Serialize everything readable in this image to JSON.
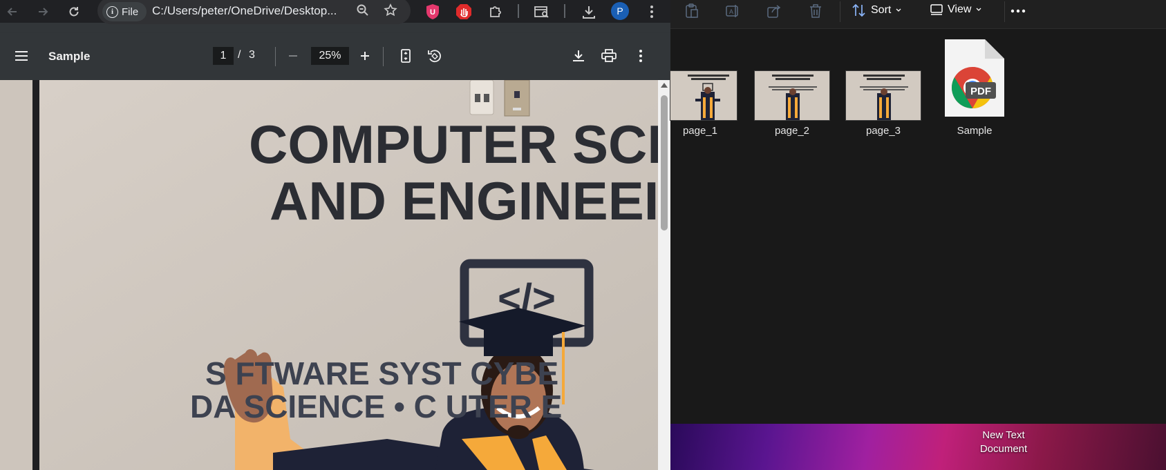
{
  "browser": {
    "back_icon": "arrow-left-icon",
    "forward_icon": "arrow-right-icon",
    "reload_icon": "reload-icon",
    "site_info": {
      "icon": "info-icon",
      "label": "File"
    },
    "url": "C:/Users/peter/OneDrive/Desktop...",
    "zoom_icon": "zoom-icon",
    "bookmark_icon": "star-icon",
    "extensions": [
      {
        "name": "ublock-extension-icon",
        "letter": "U",
        "color": "#e5386d"
      },
      {
        "name": "adblock-extension-icon",
        "color": "#e02b2b"
      },
      {
        "name": "puzzle-icon"
      }
    ],
    "profile_initial": "P"
  },
  "pdf_viewer": {
    "title": "Sample",
    "current_page": "1",
    "page_separator": "/",
    "total_pages": "3",
    "zoom": "25%"
  },
  "document": {
    "line1": "COMPUTER SCI",
    "line2": "AND ENGINEEI",
    "line3": "S   FTWARE SYST    CYBE",
    "line4": "DA   SCIENCE • C    UTER E"
  },
  "explorer": {
    "toolbar": {
      "sort_label": "Sort",
      "view_label": "View"
    },
    "files": [
      {
        "name": "page_1",
        "type": "image"
      },
      {
        "name": "page_2",
        "type": "image"
      },
      {
        "name": "page_3",
        "type": "image"
      },
      {
        "name": "Sample",
        "type": "pdf",
        "badge": "PDF"
      }
    ]
  },
  "desktop": {
    "icon_label": "New Text Document"
  }
}
